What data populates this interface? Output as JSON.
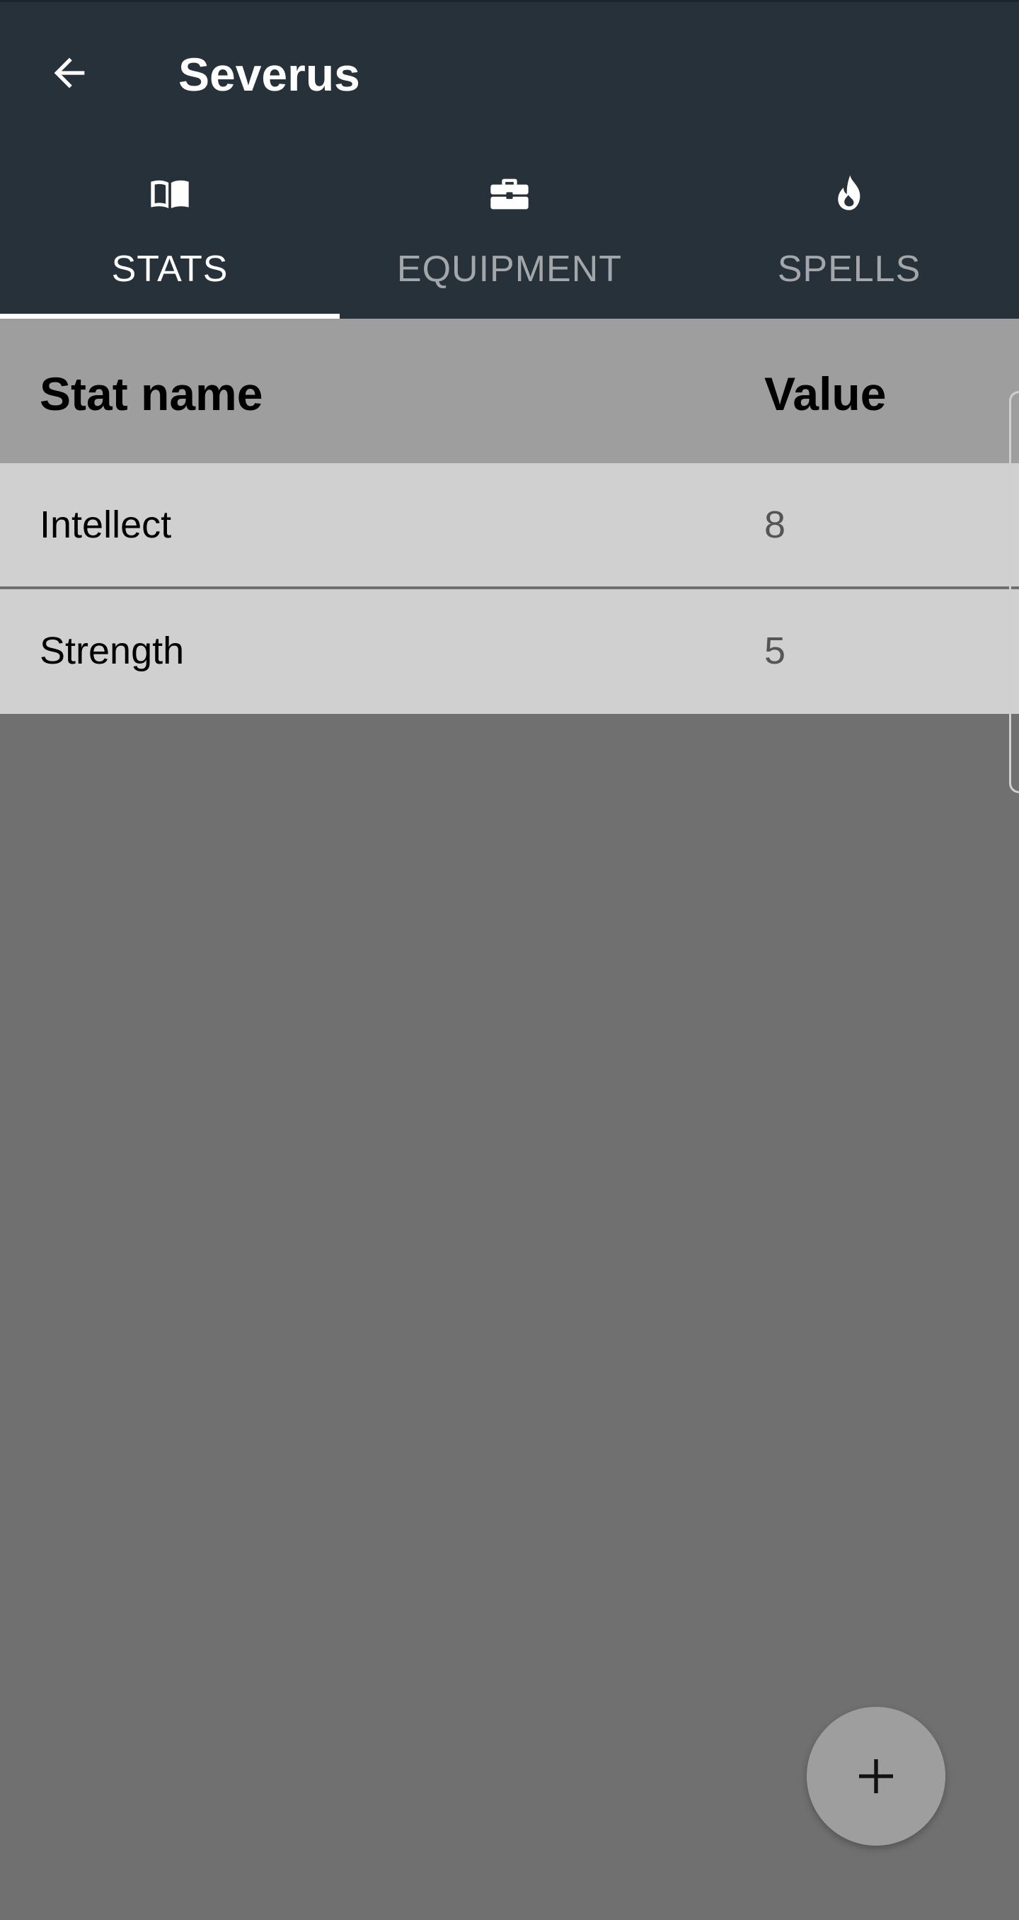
{
  "toolbar": {
    "title": "Severus",
    "back_icon": "arrow-left-icon"
  },
  "tabs": [
    {
      "label": "STATS",
      "icon": "book-icon",
      "active": true
    },
    {
      "label": "EQUIPMENT",
      "icon": "briefcase-icon",
      "active": false
    },
    {
      "label": "SPELLS",
      "icon": "flame-icon",
      "active": false
    }
  ],
  "table": {
    "headers": {
      "name": "Stat name",
      "value": "Value"
    },
    "rows": [
      {
        "name": "Intellect",
        "value": "8"
      },
      {
        "name": "Strength",
        "value": "5"
      }
    ]
  },
  "fab": {
    "icon": "plus-icon"
  },
  "colors": {
    "toolbar": "#26313a",
    "active_tab": "#ffffff",
    "inactive_tab": "#a3a7aa",
    "header_bg": "#9e9e9e",
    "row_bg": "#d0d0d0",
    "page_bg": "#707070",
    "fab_bg": "#9e9e9e"
  }
}
